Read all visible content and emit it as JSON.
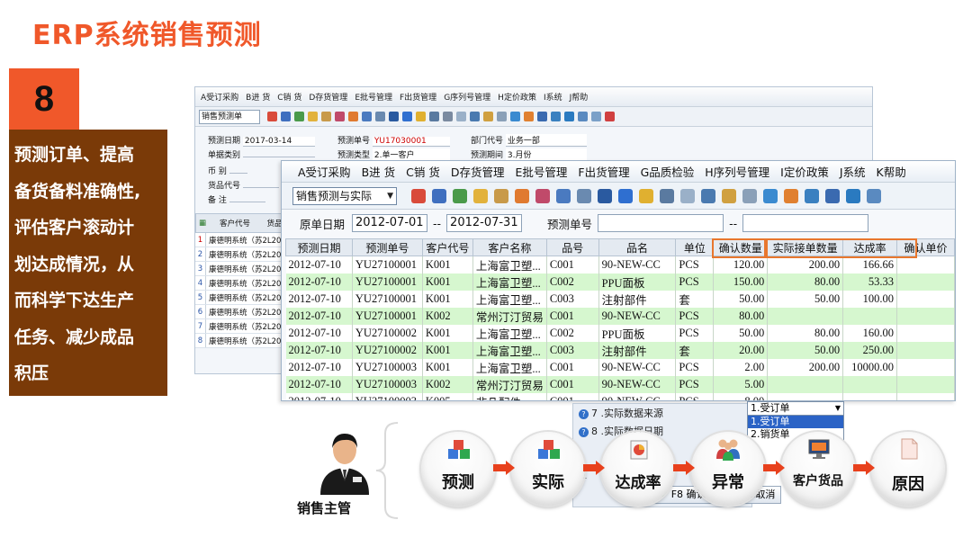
{
  "slide": {
    "title": "ERP系统销售预测",
    "step_number": "8",
    "description_lines": [
      "预测订单、提高",
      "备货备料准确性,",
      "评估客户滚动计",
      "划达成情况，从",
      "而科学下达生产",
      "任务、减少成品",
      "积压"
    ]
  },
  "back_window": {
    "menu": [
      "A受订采购",
      "B进 货",
      "C销 货",
      "D存货管理",
      "E批号管理",
      "F出货管理",
      "G序列号管理",
      "H定价政策",
      "I系统",
      "J帮助"
    ],
    "doc_select": "销售预测单",
    "form": {
      "predict_date_label": "预测日期",
      "predict_date": "2017-03-14",
      "predict_no_label": "预测单号",
      "predict_no": "YU17030001",
      "dept_code_label": "部门代号",
      "dept_code": "业务一部",
      "doc_type_label": "单据类别",
      "predict_type_label": "预测类型",
      "predict_type": "2.单一客户",
      "predict_period_label": "预测期间",
      "predict_period": "3.月份",
      "currency_label": "币 别",
      "product_code_label": "货品代号",
      "remark_label": "备 注"
    },
    "grid_headers": [
      "客户代号",
      "货品"
    ],
    "grid_rows": [
      {
        "n": "1",
        "c": "康德明系统（苏2L200"
      },
      {
        "n": "2",
        "c": "康德明系统（苏2L200"
      },
      {
        "n": "3",
        "c": "康德明系统（苏2L200"
      },
      {
        "n": "4",
        "c": "康德明系统（苏2L200"
      },
      {
        "n": "5",
        "c": "康德明系统（苏2L200"
      },
      {
        "n": "6",
        "c": "康德明系统（苏2L200"
      },
      {
        "n": "7",
        "c": "康德明系统（苏2L201"
      },
      {
        "n": "8",
        "c": "康德明系统（苏2L201"
      }
    ]
  },
  "front_window": {
    "menu": [
      "A受订采购",
      "B进 货",
      "C销 货",
      "D存货管理",
      "E批号管理",
      "F出货管理",
      "G品质检验",
      "H序列号管理",
      "I定价政策",
      "J系统",
      "K帮助"
    ],
    "report_select": "销售预测与实际",
    "filter": {
      "date_label": "原单日期",
      "date_from": "2012-07-01",
      "date_sep": "--",
      "date_to": "2012-07-31",
      "predict_no_label": "预测单号",
      "predict_no_sep": "--"
    },
    "columns": [
      "预测日期",
      "预测单号",
      "客户代号",
      "客户名称",
      "品号",
      "品名",
      "单位",
      "确认数量",
      "实际接单数量",
      "达成率",
      "确认单价"
    ],
    "rows": [
      [
        "2012-07-10",
        "YU27100001",
        "K001",
        "上海富卫塑...",
        "C001",
        "90-NEW-CC",
        "PCS",
        "120.00",
        "200.00",
        "166.66"
      ],
      [
        "2012-07-10",
        "YU27100001",
        "K001",
        "上海富卫塑...",
        "C002",
        "PPU面板",
        "PCS",
        "150.00",
        "80.00",
        "53.33"
      ],
      [
        "2012-07-10",
        "YU27100001",
        "K001",
        "上海富卫塑...",
        "C003",
        "注射部件",
        "套",
        "50.00",
        "50.00",
        "100.00"
      ],
      [
        "2012-07-10",
        "YU27100001",
        "K002",
        "常州汀汀贸易",
        "C001",
        "90-NEW-CC",
        "PCS",
        "80.00",
        "",
        ""
      ],
      [
        "2012-07-10",
        "YU27100002",
        "K001",
        "上海富卫塑...",
        "C002",
        "PPU面板",
        "PCS",
        "50.00",
        "80.00",
        "160.00"
      ],
      [
        "2012-07-10",
        "YU27100002",
        "K001",
        "上海富卫塑...",
        "C003",
        "注射部件",
        "套",
        "20.00",
        "50.00",
        "250.00"
      ],
      [
        "2012-07-10",
        "YU27100003",
        "K001",
        "上海富卫塑...",
        "C001",
        "90-NEW-CC",
        "PCS",
        "2.00",
        "200.00",
        "10000.00"
      ],
      [
        "2012-07-10",
        "YU27100003",
        "K002",
        "常州汀汀贸易",
        "C001",
        "90-NEW-CC",
        "PCS",
        "5.00",
        "",
        ""
      ],
      [
        "2012-07-10",
        "YU27100003",
        "K005",
        "非凡配件",
        "C001",
        "90-NEW-CC",
        "PCS",
        "8.00",
        "",
        ""
      ]
    ]
  },
  "popup": {
    "item7": "7 .实际数据来源",
    "item8": "8 .实际数据日期",
    "side_label": "性",
    "dropdown_selected": "1.受订单",
    "dropdown_options": [
      "1.受订单",
      "2.销货单"
    ],
    "ok_label": "F8 确认",
    "cancel_label": "ESC取消"
  },
  "flow": {
    "manager_label": "销售主管",
    "steps": [
      "预测",
      "实际",
      "达成率",
      "异常",
      "客户货品",
      "原因"
    ]
  },
  "colors": {
    "accent": "#f0582a",
    "desc_bg": "#7a3a08",
    "row_green": "#d6f7cf",
    "highlight": "#e8772e"
  }
}
